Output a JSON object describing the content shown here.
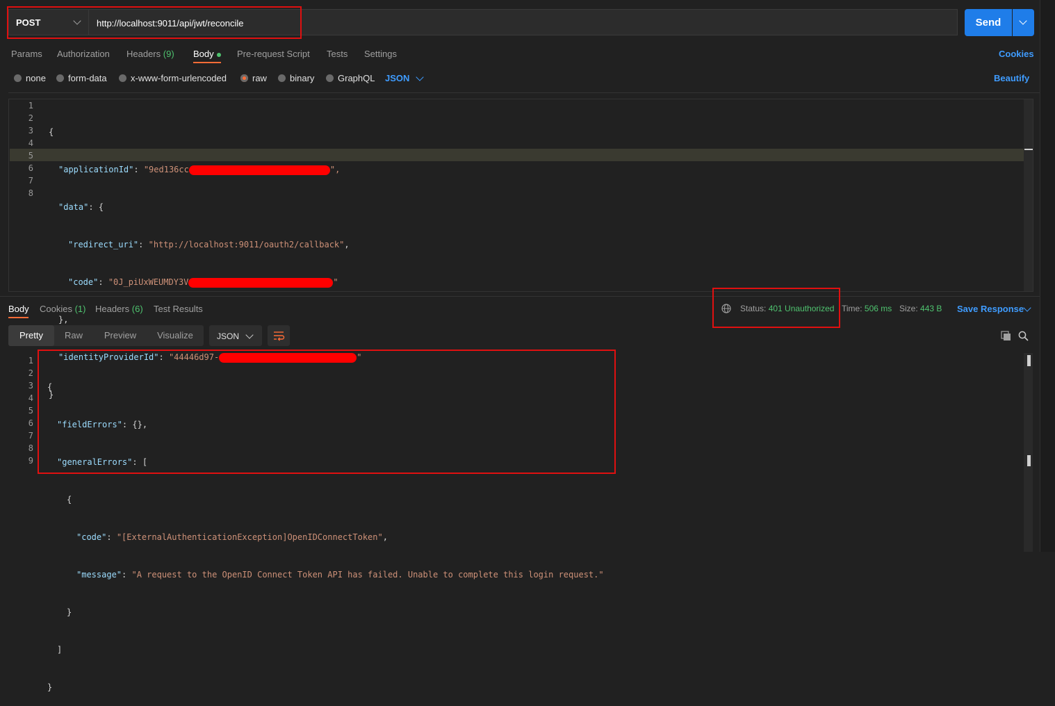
{
  "request": {
    "method": "POST",
    "url": "http://localhost:9011/api/jwt/reconcile",
    "send_label": "Send"
  },
  "request_tabs": {
    "params": "Params",
    "authorization": "Authorization",
    "headers": "Headers",
    "headers_count": "(9)",
    "body": "Body",
    "prerequest": "Pre-request Script",
    "tests": "Tests",
    "settings": "Settings",
    "cookies": "Cookies"
  },
  "body_types": {
    "none": "none",
    "form_data": "form-data",
    "urlencoded": "x-www-form-urlencoded",
    "raw": "raw",
    "binary": "binary",
    "graphql": "GraphQL",
    "format": "JSON",
    "beautify": "Beautify"
  },
  "request_body": {
    "line_numbers": [
      "1",
      "2",
      "3",
      "4",
      "5",
      "6",
      "7",
      "8"
    ],
    "open_brace": "{",
    "application_id_key": "\"applicationId\"",
    "application_id_value": "\"9ed136cc",
    "data_key": "\"data\"",
    "redirect_uri_key": "\"redirect_uri\"",
    "redirect_uri_value": "\"http://localhost:9011/oauth2/callback\"",
    "code_key": "\"code\"",
    "code_value": "\"0J_piUxWEUMDY3V",
    "identity_provider_key": "\"identityProviderId\"",
    "identity_provider_value": "\"44446d97-",
    "close_brace": "}"
  },
  "response_tabs": {
    "body": "Body",
    "cookies": "Cookies",
    "cookies_count": "(1)",
    "headers": "Headers",
    "headers_count": "(6)",
    "test_results": "Test Results"
  },
  "response_meta": {
    "status_label": "Status:",
    "status_value": "401 Unauthorized",
    "time_label": "Time:",
    "time_value": "506 ms",
    "size_label": "Size:",
    "size_value": "443 B",
    "save_response": "Save Response"
  },
  "view_modes": {
    "pretty": "Pretty",
    "raw": "Raw",
    "preview": "Preview",
    "visualize": "Visualize",
    "format": "JSON"
  },
  "response_body": {
    "line_numbers": [
      "1",
      "2",
      "3",
      "4",
      "5",
      "6",
      "7",
      "8",
      "9"
    ],
    "open_brace": "{",
    "field_errors_key": "\"fieldErrors\"",
    "field_errors_value": "{}",
    "general_errors_key": "\"generalErrors\"",
    "array_open": "[",
    "obj_open": "{",
    "code_key": "\"code\"",
    "code_value": "\"[ExternalAuthenticationException]OpenIDConnectToken\"",
    "message_key": "\"message\"",
    "message_value": "\"A request to the OpenID Connect Token API has failed. Unable to complete this login request.\"",
    "obj_close": "}",
    "array_close": "]",
    "close_brace": "}"
  },
  "colors": {
    "accent": "#ff6c37",
    "primary_button": "#1f7de9",
    "status_ok_green": "#4fc36f",
    "highlight_red": "#e01010"
  }
}
